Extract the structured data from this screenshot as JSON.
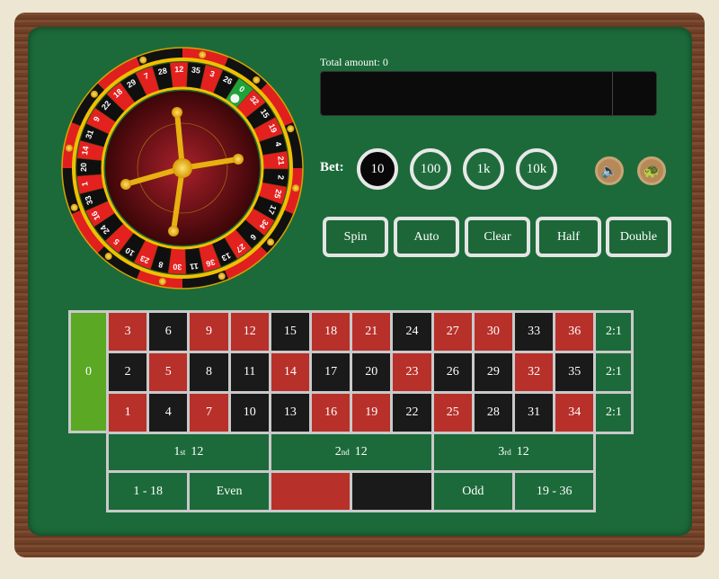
{
  "header": {
    "total_label": "Total amount: 0"
  },
  "bet": {
    "label": "Bet:",
    "chips": [
      {
        "label": "10",
        "selected": true
      },
      {
        "label": "100",
        "selected": false
      },
      {
        "label": "1k",
        "selected": false
      },
      {
        "label": "10k",
        "selected": false
      }
    ]
  },
  "icons": {
    "sound": "speaker-icon",
    "speed": "turtle-icon"
  },
  "buttons": [
    "Spin",
    "Auto",
    "Clear",
    "Half",
    "Double"
  ],
  "wheel": {
    "numbers": [
      0,
      32,
      15,
      19,
      4,
      21,
      2,
      25,
      17,
      34,
      6,
      27,
      13,
      36,
      11,
      30,
      8,
      23,
      10,
      5,
      24,
      16,
      33,
      1,
      20,
      14,
      31,
      9,
      22,
      18,
      29,
      7,
      28,
      12,
      35,
      3,
      26
    ],
    "ball_on": 0
  },
  "table": {
    "zero": "0",
    "rows": [
      [
        3,
        6,
        9,
        12,
        15,
        18,
        21,
        24,
        27,
        30,
        33,
        36
      ],
      [
        2,
        5,
        8,
        11,
        14,
        17,
        20,
        23,
        26,
        29,
        32,
        35
      ],
      [
        1,
        4,
        7,
        10,
        13,
        16,
        19,
        22,
        25,
        28,
        31,
        34
      ]
    ],
    "red_numbers": [
      1,
      3,
      5,
      7,
      9,
      12,
      14,
      16,
      18,
      19,
      21,
      23,
      25,
      27,
      30,
      32,
      34,
      36
    ],
    "columns": [
      "2:1",
      "2:1",
      "2:1"
    ],
    "dozens": [
      {
        "n": "1",
        "sup": "st",
        "label": "12"
      },
      {
        "n": "2",
        "sup": "nd",
        "label": "12"
      },
      {
        "n": "3",
        "sup": "rd",
        "label": "12"
      }
    ],
    "outside": [
      "1 - 18",
      "Even",
      "",
      "",
      "Odd",
      "19 - 36"
    ]
  },
  "colors": {
    "felt": "#1c6a3a",
    "red": "#b8302a",
    "black": "#1a1a1a",
    "zero": "#5aa823",
    "border": "#c9c9c9"
  }
}
